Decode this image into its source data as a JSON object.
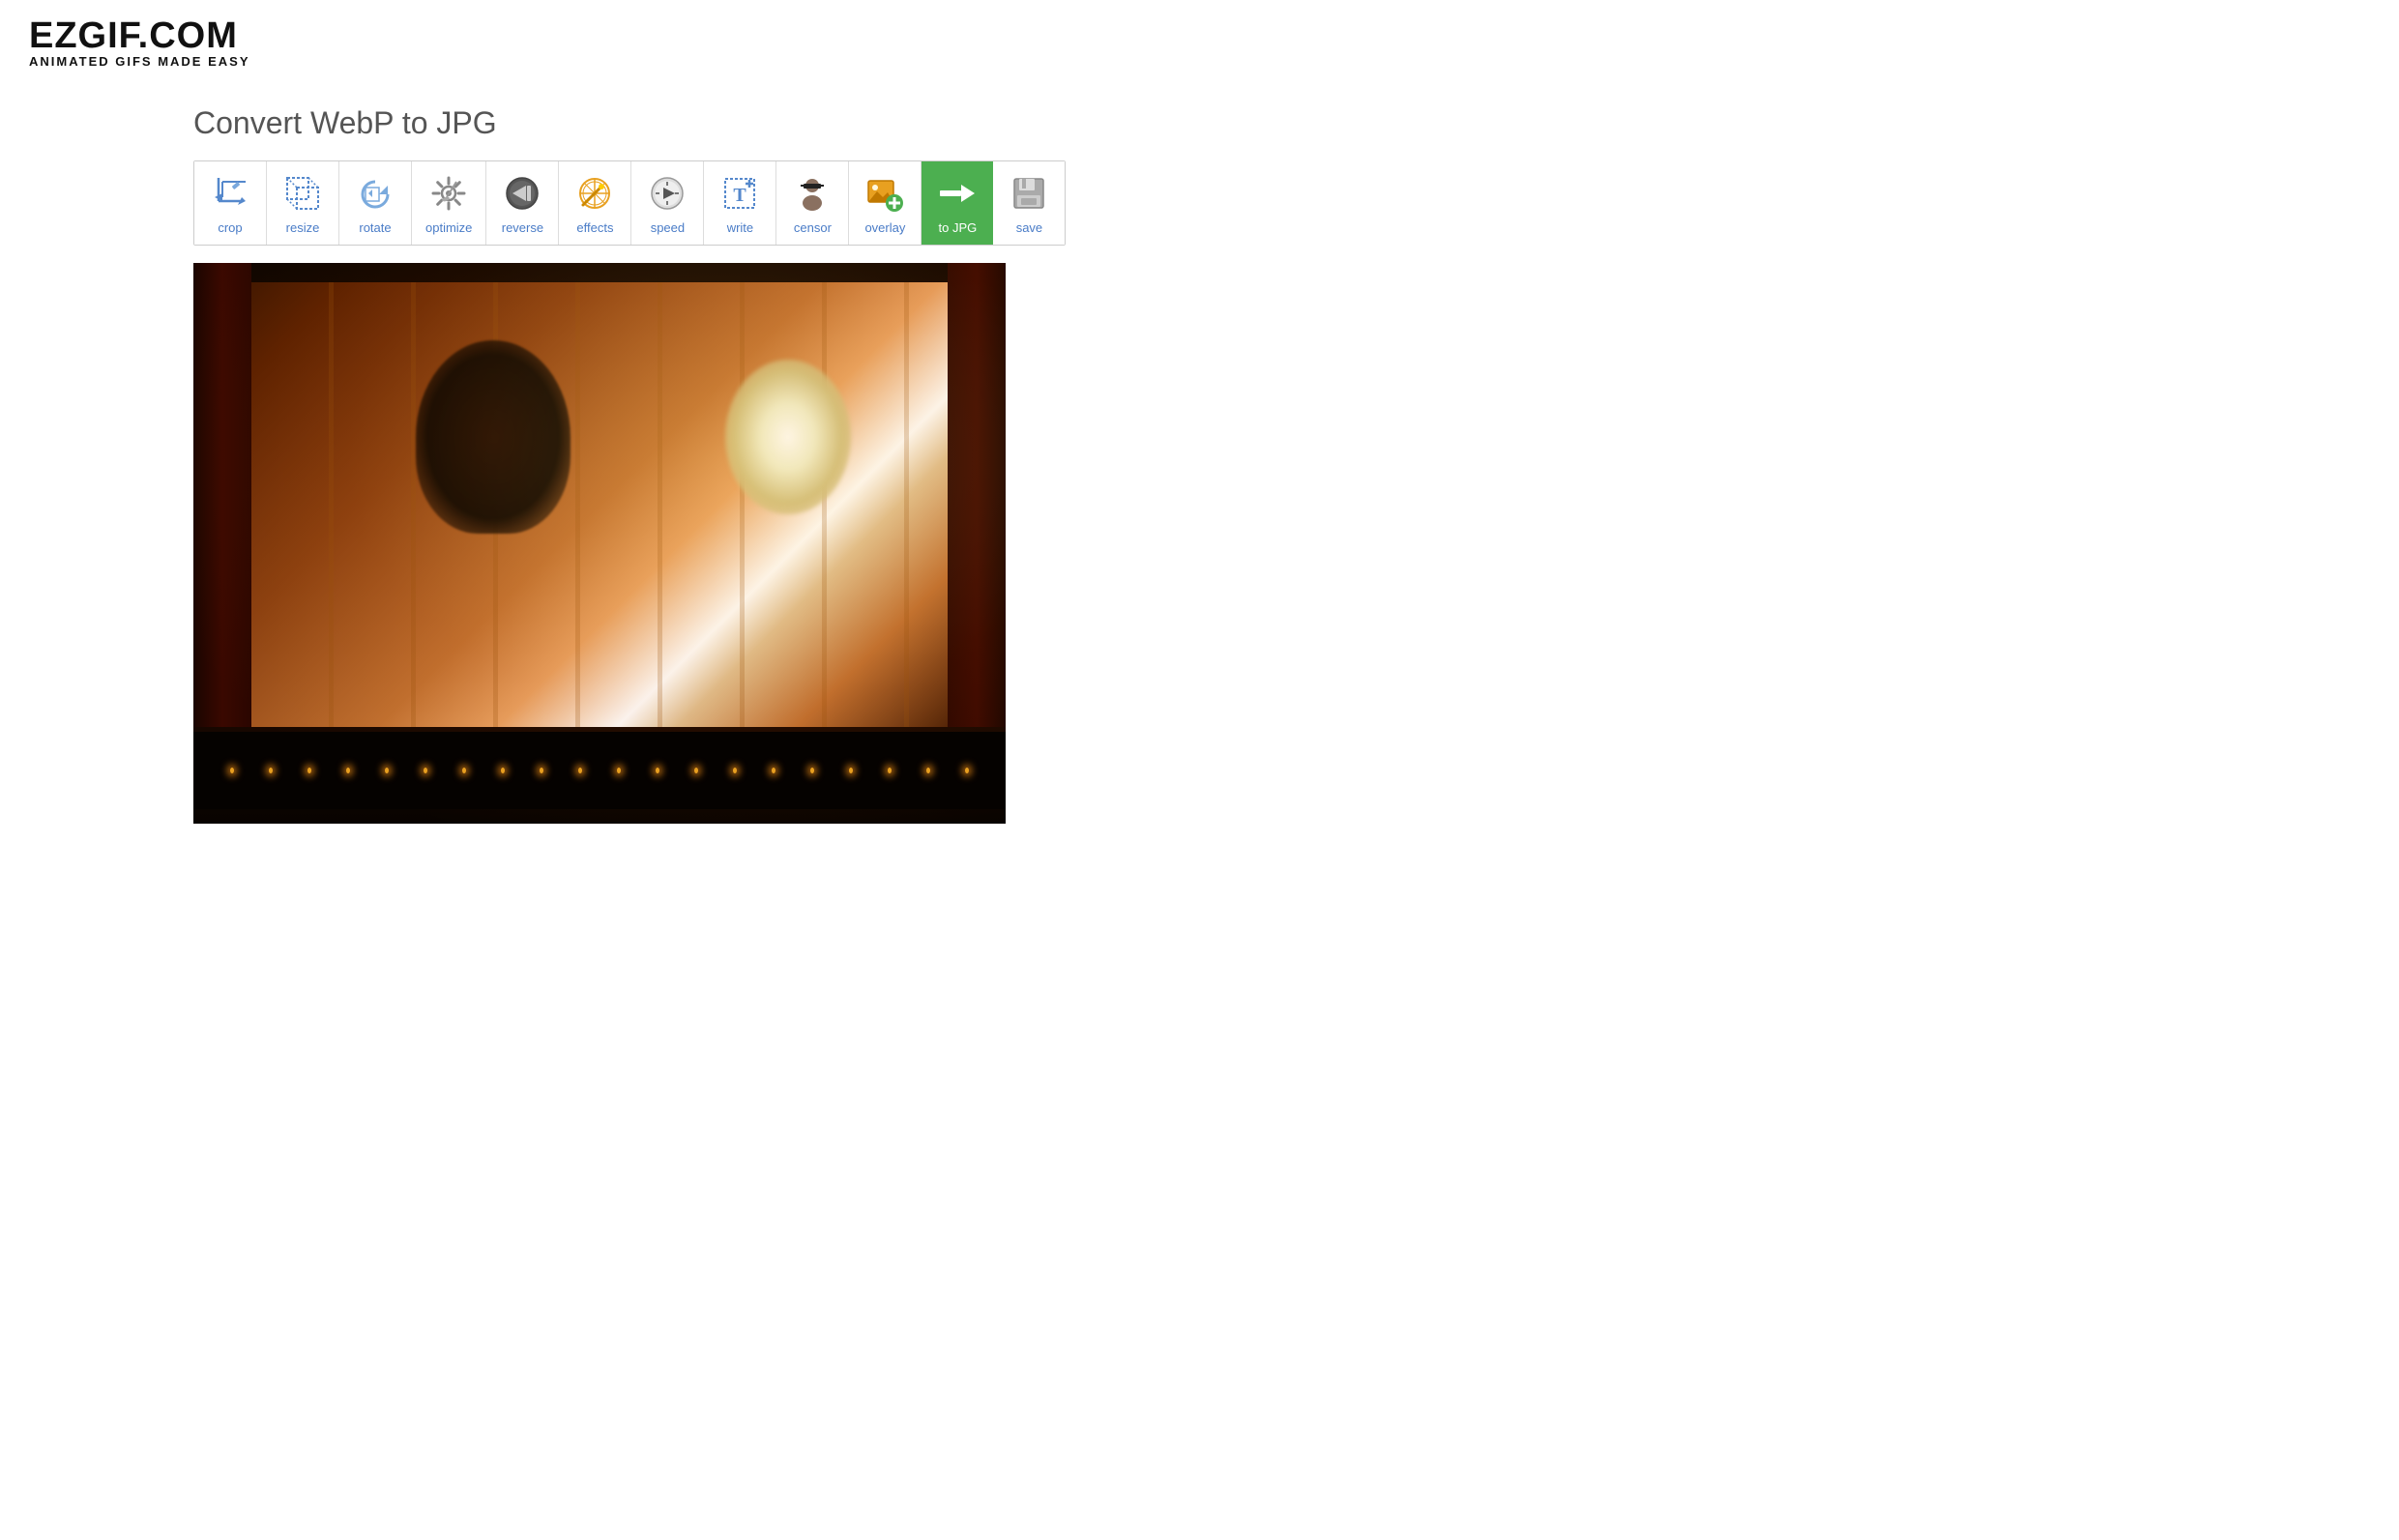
{
  "logo": {
    "brand": "EZGIF.COM",
    "tagline": "ANIMATED GIFS MADE EASY"
  },
  "page": {
    "title": "Convert WebP to JPG"
  },
  "toolbar": {
    "tools": [
      {
        "id": "crop",
        "label": "crop",
        "icon": "crop"
      },
      {
        "id": "resize",
        "label": "resize",
        "icon": "resize"
      },
      {
        "id": "rotate",
        "label": "rotate",
        "icon": "rotate"
      },
      {
        "id": "optimize",
        "label": "optimize",
        "icon": "optimize"
      },
      {
        "id": "reverse",
        "label": "reverse",
        "icon": "reverse"
      },
      {
        "id": "effects",
        "label": "effects",
        "icon": "effects"
      },
      {
        "id": "speed",
        "label": "speed",
        "icon": "speed"
      },
      {
        "id": "write",
        "label": "write",
        "icon": "write"
      },
      {
        "id": "censor",
        "label": "censor",
        "icon": "censor"
      },
      {
        "id": "overlay",
        "label": "overlay",
        "icon": "overlay"
      },
      {
        "id": "tojpg",
        "label": "to JPG",
        "icon": "tojpg",
        "active": true
      },
      {
        "id": "save",
        "label": "save",
        "icon": "save"
      }
    ]
  },
  "stage_lights": [
    1,
    2,
    3,
    4,
    5,
    6,
    7,
    8,
    9,
    10,
    11,
    12,
    13,
    14,
    15,
    16,
    17,
    18,
    19,
    20
  ]
}
